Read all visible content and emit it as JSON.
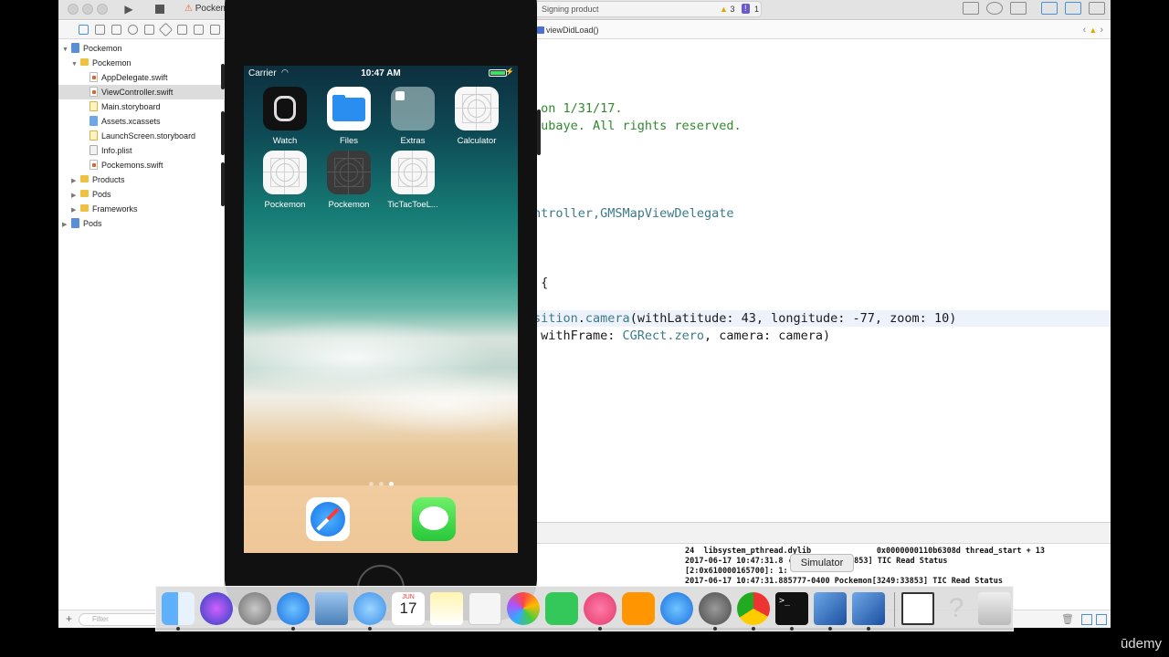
{
  "toolbar": {
    "scheme_label": "Pockemon",
    "activity_text": "Signing product",
    "warning_count": "3",
    "error_count": "1"
  },
  "jump_bar": {
    "function": "viewDidLoad()"
  },
  "navigator": {
    "items": [
      {
        "label": "Pockemon",
        "icon": "project-icon"
      },
      {
        "label": "Pockemon",
        "icon": "folder-icon"
      },
      {
        "label": "AppDelegate.swift",
        "icon": "swift-file-icon"
      },
      {
        "label": "ViewController.swift",
        "icon": "swift-file-icon",
        "selected": true
      },
      {
        "label": "Main.storyboard",
        "icon": "storyboard-icon"
      },
      {
        "label": "Assets.xcassets",
        "icon": "assets-icon"
      },
      {
        "label": "LaunchScreen.storyboard",
        "icon": "storyboard-icon"
      },
      {
        "label": "Info.plist",
        "icon": "plist-icon"
      },
      {
        "label": "Pockemons.swift",
        "icon": "swift-file-icon"
      },
      {
        "label": "Products",
        "icon": "folder-icon"
      },
      {
        "label": "Pods",
        "icon": "folder-icon"
      },
      {
        "label": "Frameworks",
        "icon": "folder-icon"
      },
      {
        "label": "Pods",
        "icon": "project-icon"
      }
    ],
    "filter_placeholder": "Filter"
  },
  "editor": {
    "lines": [
      {
        "text": " on 1/31/17."
      },
      {
        "text": "rubaye. All rights reserved."
      },
      {
        "text": "ntroller,",
        "suffix": "GMSMapViewDelegate"
      },
      {
        "text": " {"
      },
      {
        "a": "sition",
        "b": ".",
        "c": "camera",
        "d": "(withLatitude: 43, longitude: -77, zoom: 10)"
      },
      {
        "a": " withFrame: ",
        "b": "CGRect",
        "c": ".zero",
        "d": ", camera: camera)"
      }
    ]
  },
  "console": {
    "lines": [
      "24  libsystem_pthread.dylib              0x0000000110b6308d thread_start + 13",
      "2017-06-17 10:47:31.8",
      "[2:0x610000165700]: 1:",
      "2017-06-17 10:47:31.885777-0400 Pockemon[3249:33853] TIC Read Status"
    ],
    "line2_suffix": "ckemon[3249:33853] TIC Read Status"
  },
  "simulator": {
    "carrier": "Carrier",
    "time": "10:47 AM",
    "apps": [
      {
        "label": "Watch"
      },
      {
        "label": "Files"
      },
      {
        "label": "Extras"
      },
      {
        "label": "Calculator"
      },
      {
        "label": "Pockemon"
      },
      {
        "label": "Pockemon"
      },
      {
        "label": "TicTacToeL..."
      }
    ],
    "page_count": 3,
    "current_page": 3
  },
  "dock": {
    "tooltip": "Simulator",
    "calendar_month": "JUN",
    "calendar_day": "17"
  },
  "watermark": "ūdemy",
  "colors": {
    "comment": "#2f8a2f",
    "type": "#3b7a8c",
    "selection": "#dcdcdc"
  }
}
